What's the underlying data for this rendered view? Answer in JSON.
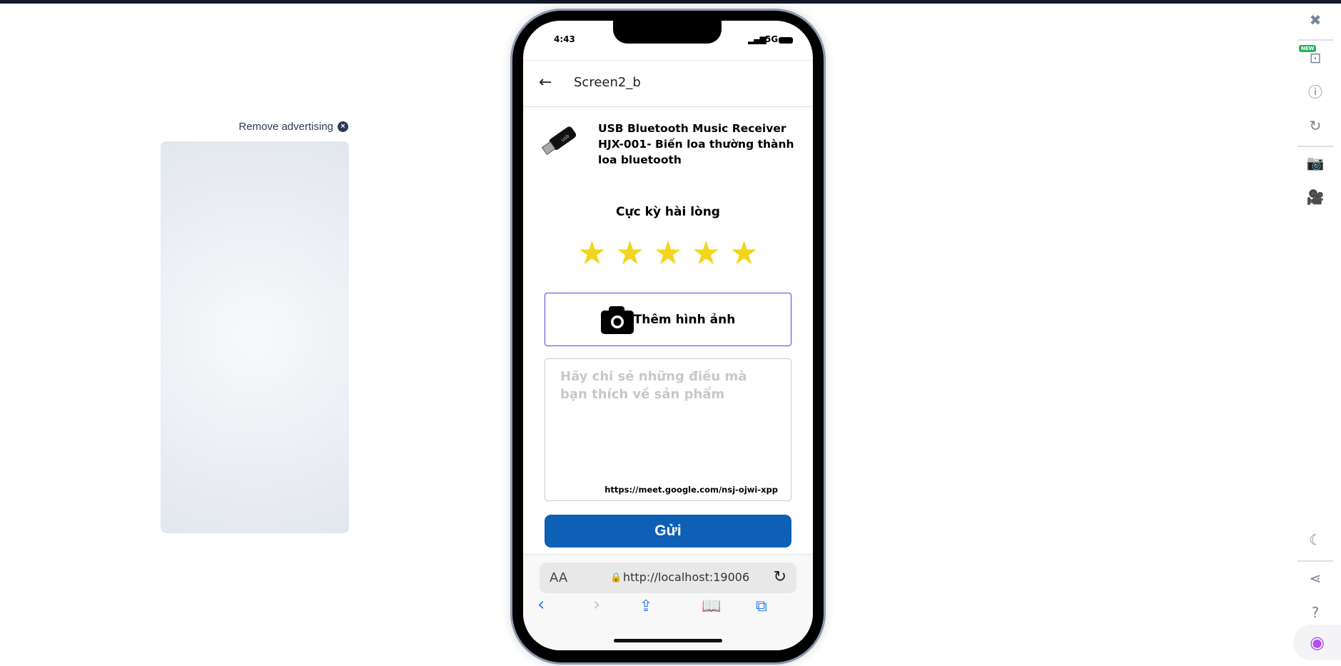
{
  "ad": {
    "remove_label": "Remove advertising"
  },
  "status": {
    "time": "4:43",
    "network": "5G"
  },
  "header": {
    "title": "Screen2_b"
  },
  "product": {
    "name": "USB Bluetooth Music Receiver HJX-001- Biến loa thường thành loa bluetooth"
  },
  "rating": {
    "label": "Cực kỳ hài lòng",
    "value": 5,
    "max": 5,
    "star_color": "#f2d51f"
  },
  "add_image": {
    "label": "Thêm hình ảnh"
  },
  "review": {
    "placeholder": "Hãy chi sẻ những điều mà bạn thích về sản phẩm",
    "overlay_text": "https://meet.google.com/nsj-ojwi-xpp"
  },
  "submit": {
    "label": "Gửi",
    "color": "#0e5fb6"
  },
  "browser": {
    "aa": "AA",
    "url": "http://localhost:19006"
  },
  "sidebar": {
    "new_badge": "NEW"
  }
}
